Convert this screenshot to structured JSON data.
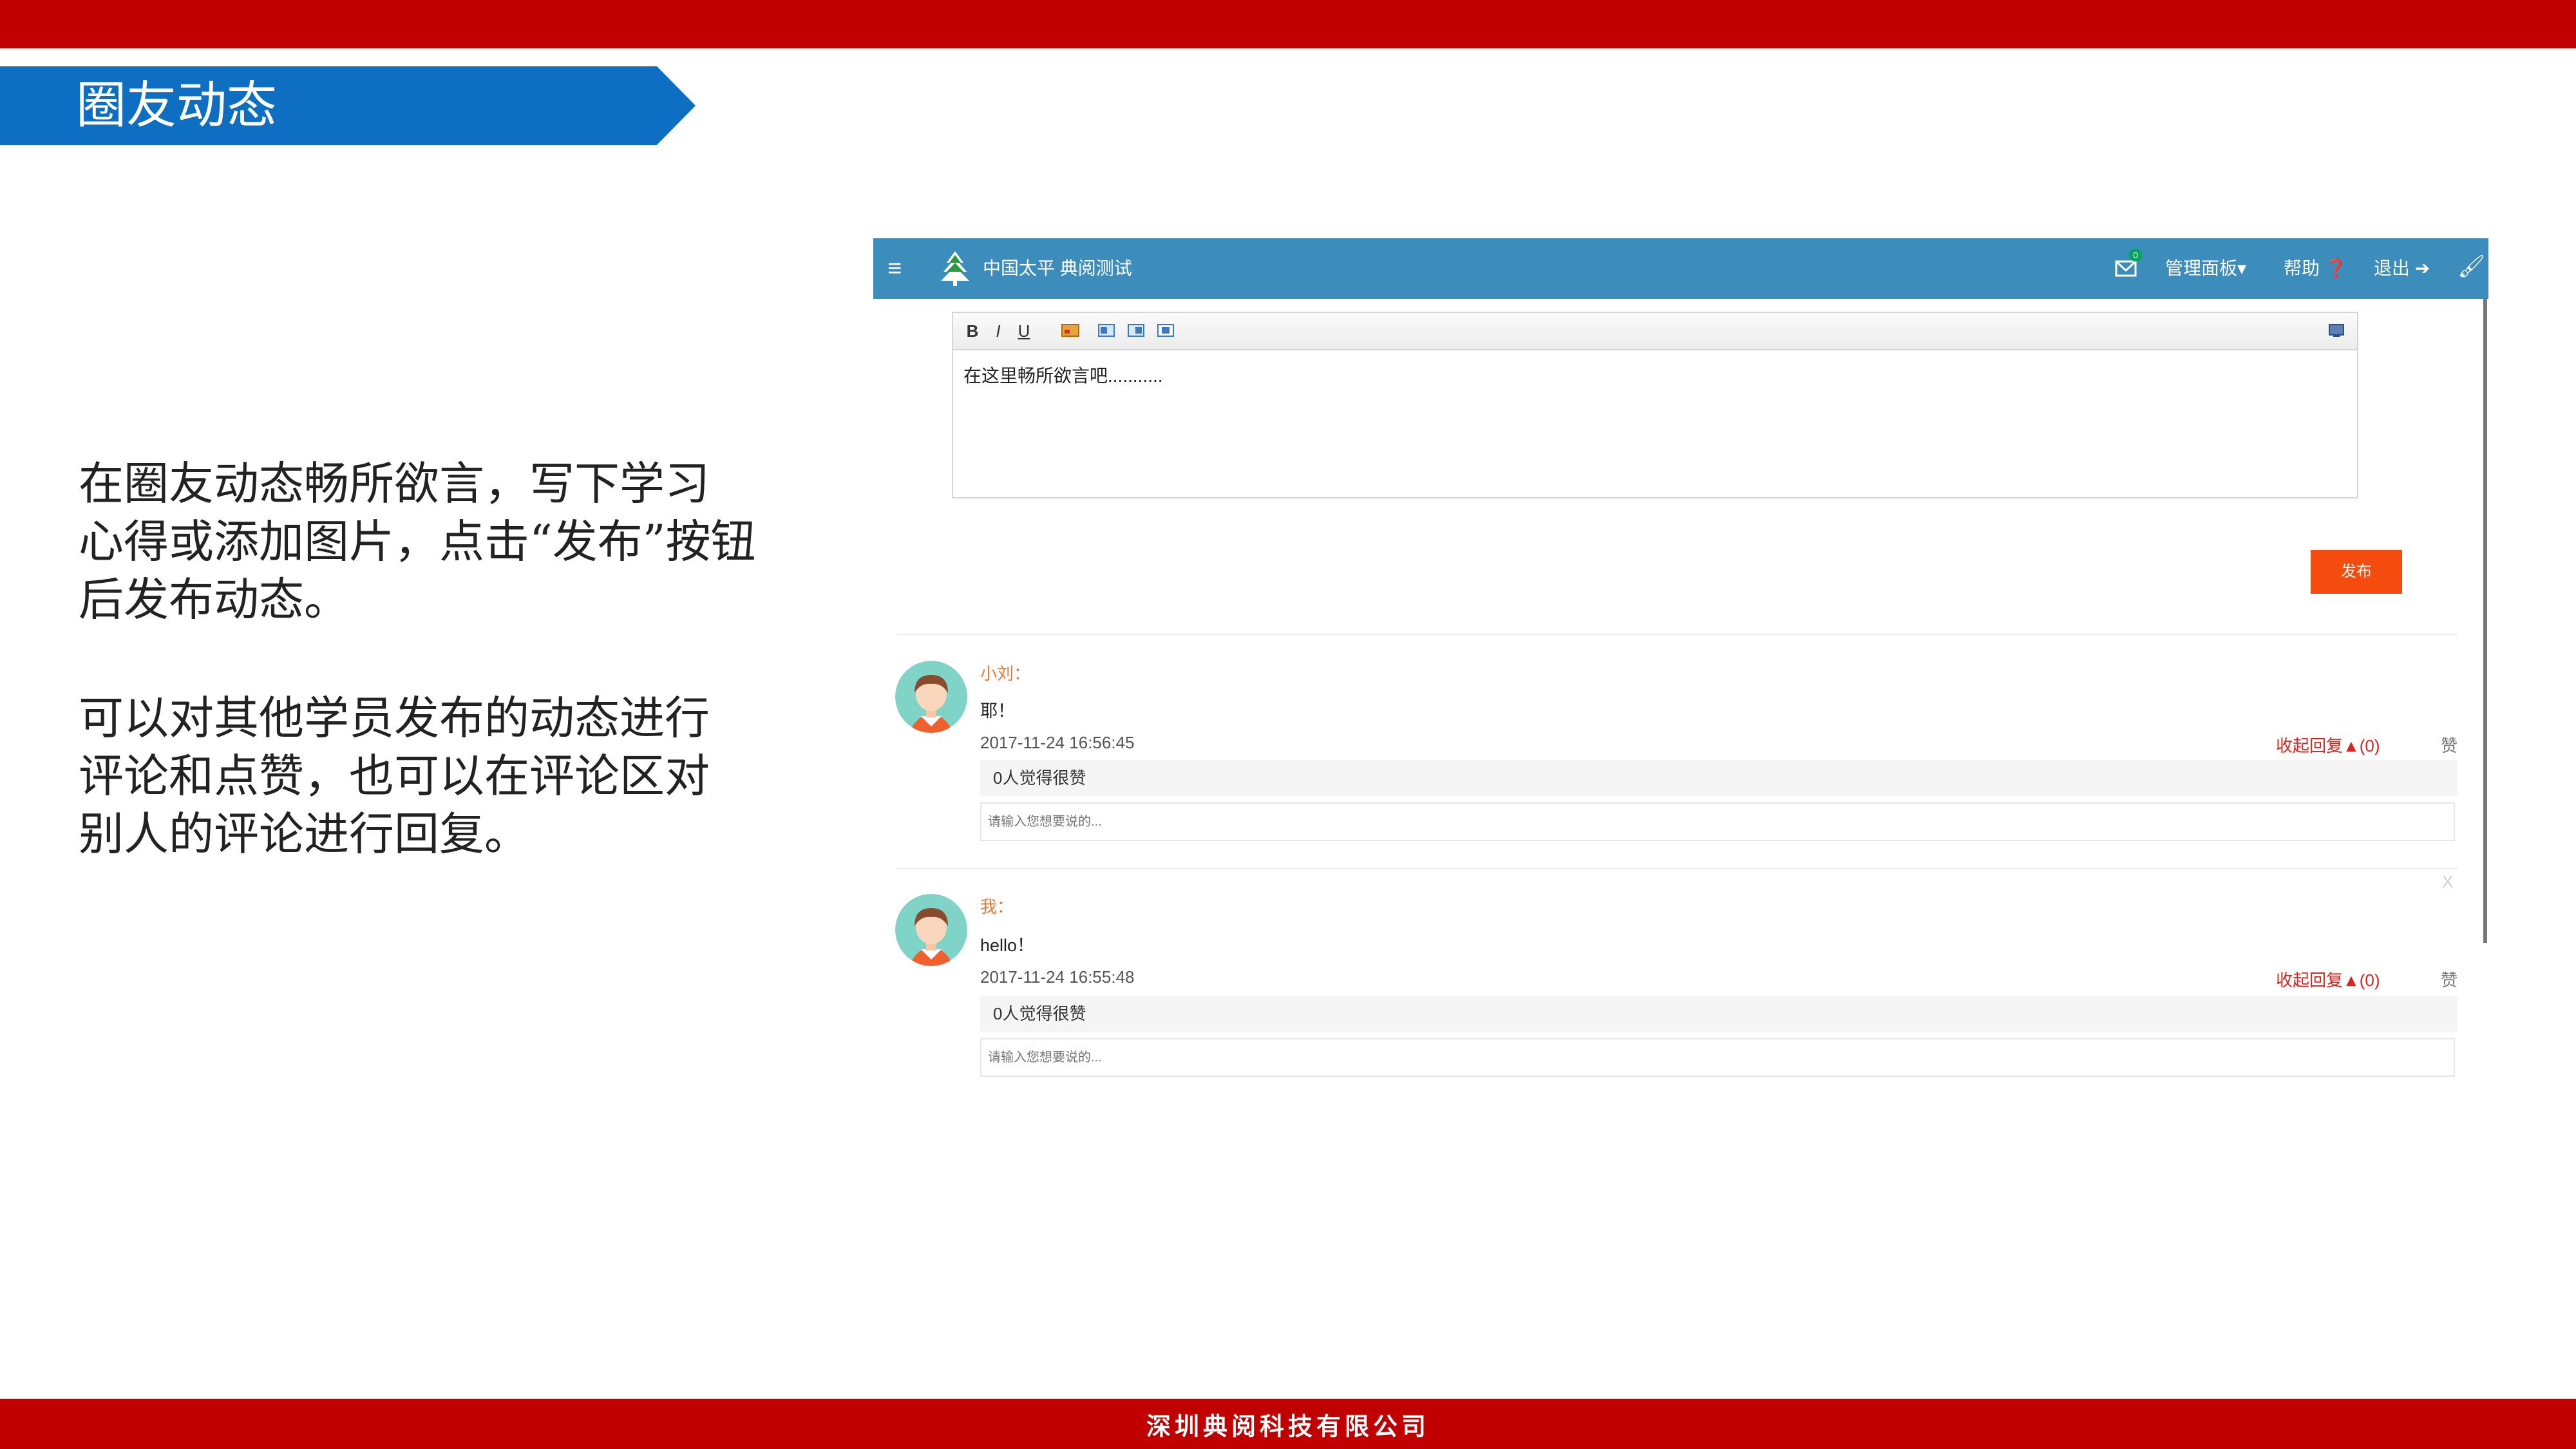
{
  "slide": {
    "title": "圈友动态",
    "desc1_line1": "在圈友动态畅所欲言，写下学习",
    "desc1_line2": "心得或添加图片，点击“发布”按钮",
    "desc1_line3": "后发布动态。",
    "desc2_line1": "可以对其他学员发布的动态进行",
    "desc2_line2": "评论和点赞，也可以在评论区对",
    "desc2_line3": "别人的评论进行回复。",
    "footer": "深圳典阅科技有限公司",
    "colors": {
      "red_bar": "#c00000",
      "title_blue": "#0e6fc2"
    }
  },
  "app": {
    "header": {
      "site_title": "中国太平 典阅测试",
      "mail_badge": "0",
      "manage": "管理面板▾",
      "help": "帮助 ❓",
      "logout": "退出 ➔",
      "color": "#3c8dbc"
    },
    "editor": {
      "toolbar": {
        "bold": "B",
        "italic": "I",
        "underline": "U"
      },
      "content": "在这里畅所欲言吧..........."
    },
    "publish_label": "发布",
    "posts": [
      {
        "name": "小刘：",
        "body": "耶！",
        "time": "2017-11-24 16:56:45",
        "reply_toggle": "收起回复▲(0)",
        "like": "赞",
        "likes": "0人觉得很赞",
        "comment_placeholder": "请输入您想要说的..."
      },
      {
        "name": "我：",
        "body": "hello！",
        "time": "2017-11-24 16:55:48",
        "reply_toggle": "收起回复▲(0)",
        "like": "赞",
        "likes": "0人觉得很赞",
        "comment_placeholder": "请输入您想要说的...",
        "close": "X"
      }
    ]
  }
}
